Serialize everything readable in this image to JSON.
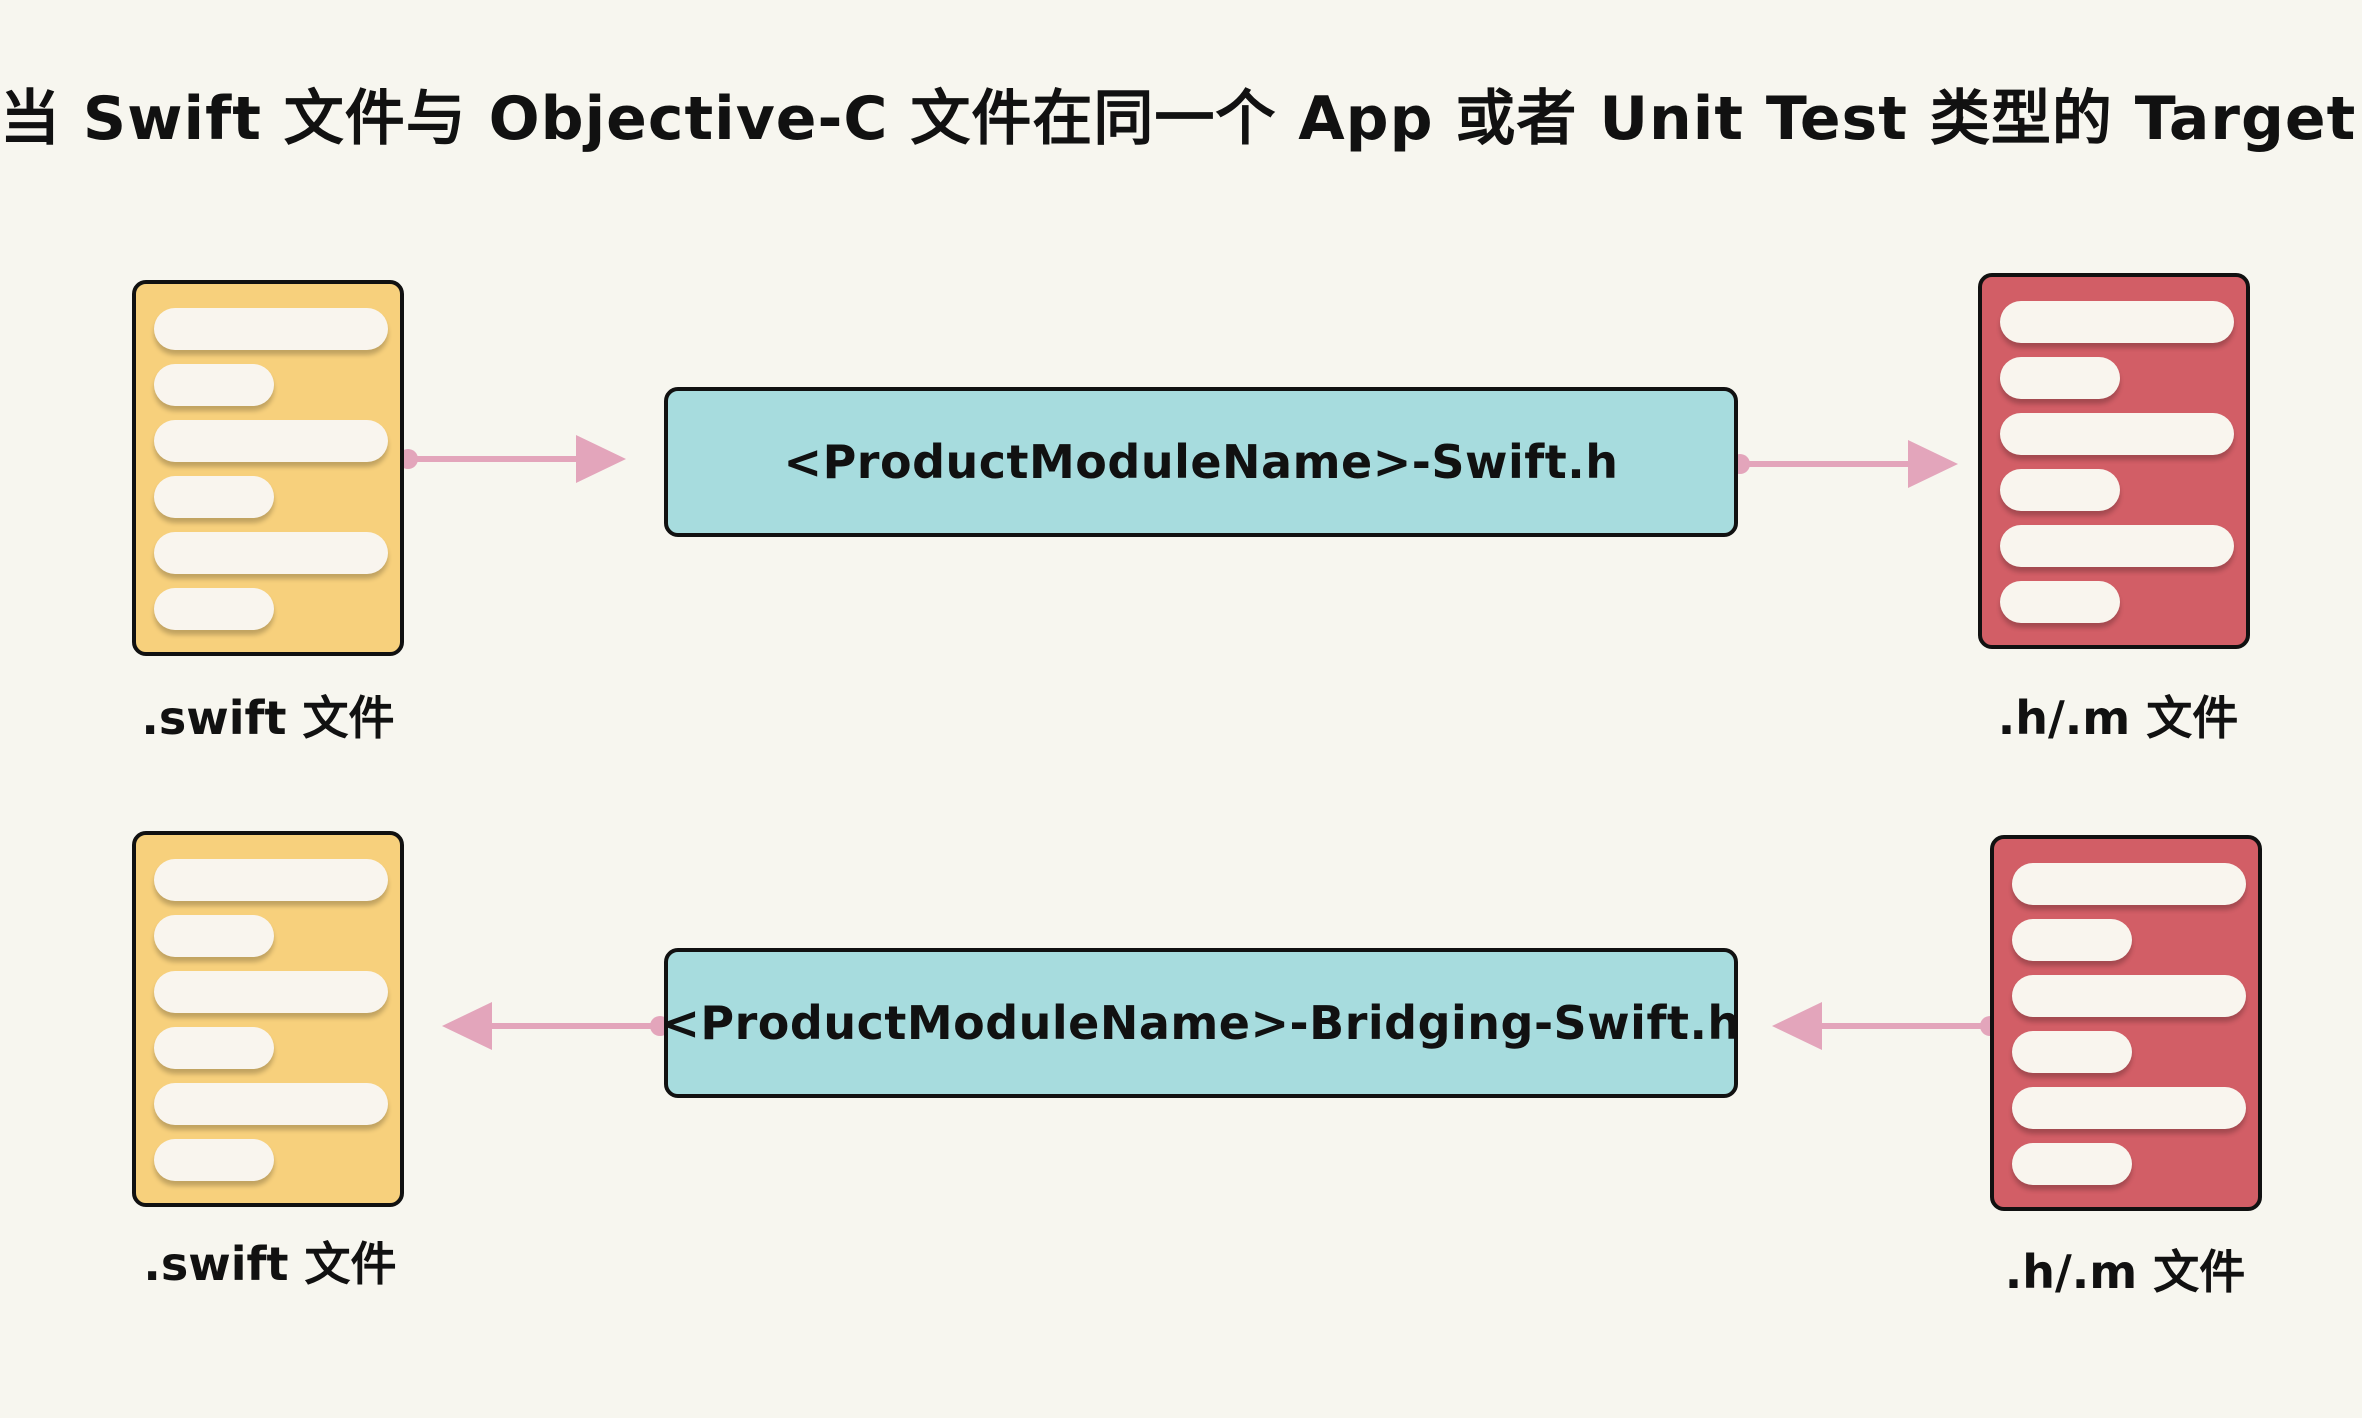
{
  "title": "当 Swift 文件与 Objective-C 文件在同一个 App 或者 Unit Test 类型的 Target 中",
  "colors": {
    "background": "#f7f6ef",
    "swift_file": "#f7d07c",
    "objc_file": "#d25e66",
    "header_box": "#a7dcde",
    "arrow": "#e3a5bb",
    "file_line": "#f9f5ee",
    "border": "#111111"
  },
  "top_row": {
    "left_file": {
      "label": ".swift 文件",
      "kind": "swift-file-icon"
    },
    "header": {
      "label": "<ProductModuleName>-Swift.h"
    },
    "right_file": {
      "label": ".h/.m 文件",
      "kind": "objc-file-icon"
    },
    "flow": "left-to-right"
  },
  "bottom_row": {
    "left_file": {
      "label": ".swift 文件",
      "kind": "swift-file-icon"
    },
    "header": {
      "label": "<ProductModuleName>-Bridging-Swift.h"
    },
    "right_file": {
      "label": ".h/.m 文件",
      "kind": "objc-file-icon"
    },
    "flow": "right-to-left"
  }
}
